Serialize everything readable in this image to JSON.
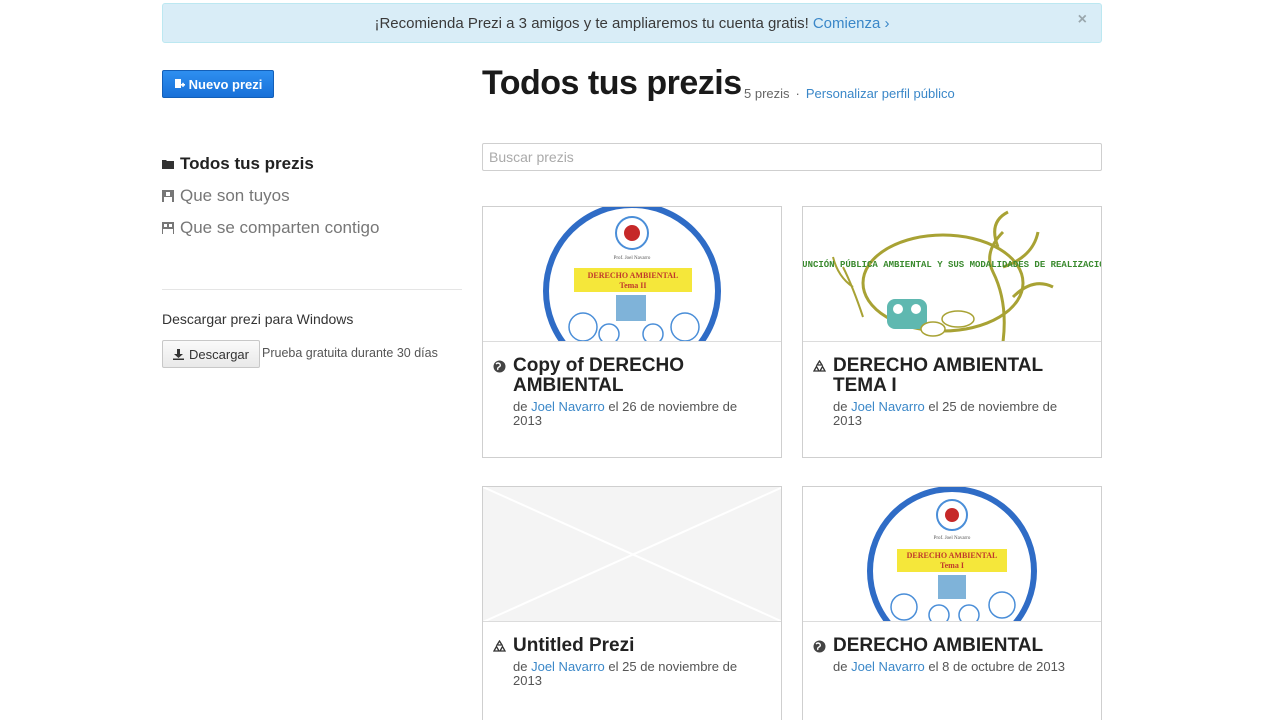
{
  "banner": {
    "text": "¡Recomienda Prezi a 3 amigos y te ampliaremos tu cuenta gratis!",
    "link": "Comienza ›",
    "close": "×"
  },
  "new_button": {
    "label": "Nuevo prezi"
  },
  "header": {
    "title": "Todos tus prezis",
    "count": "5 prezis",
    "separator": "·",
    "profile_link": "Personalizar perfil público"
  },
  "nav": {
    "items": [
      {
        "label": "Todos tus prezis",
        "icon": "folder-icon"
      },
      {
        "label": "Que son tuyos",
        "icon": "user-icon"
      },
      {
        "label": "Que se comparten contigo",
        "icon": "users-icon"
      }
    ]
  },
  "download": {
    "title": "Descargar prezi para Windows",
    "button": "Descargar",
    "note": "Prueba gratuita durante 30 días"
  },
  "search": {
    "placeholder": "Buscar prezis"
  },
  "cards": [
    {
      "title": "Copy of DERECHO AMBIENTAL",
      "by": "de",
      "author": "Joel Navarro",
      "date": "el 26 de noviembre de 2013",
      "icon": "globe-icon",
      "thumb_title": "DERECHO AMBIENTAL",
      "thumb_sub": "Tema II",
      "thumb_name": "Prof. Joel Navarro"
    },
    {
      "title": "DERECHO AMBIENTAL TEMA I",
      "by": "de",
      "author": "Joel Navarro",
      "date": "el 25 de noviembre de 2013",
      "icon": "recycle-icon",
      "thumb_title": "LA FUNCIÓN PÚBLICA AMBIENTAL Y SUS MODALIDADES DE REALIZACIÓN."
    },
    {
      "title": "Untitled Prezi",
      "by": "de",
      "author": "Joel Navarro",
      "date": "el 25 de noviembre de 2013",
      "icon": "recycle-icon"
    },
    {
      "title": "DERECHO AMBIENTAL",
      "by": "de",
      "author": "Joel Navarro",
      "date": "el 8 de octubre de 2013",
      "icon": "globe-icon",
      "thumb_title": "DERECHO AMBIENTAL",
      "thumb_sub": "Tema I",
      "thumb_name": "Prof. Joel Navarro"
    }
  ]
}
